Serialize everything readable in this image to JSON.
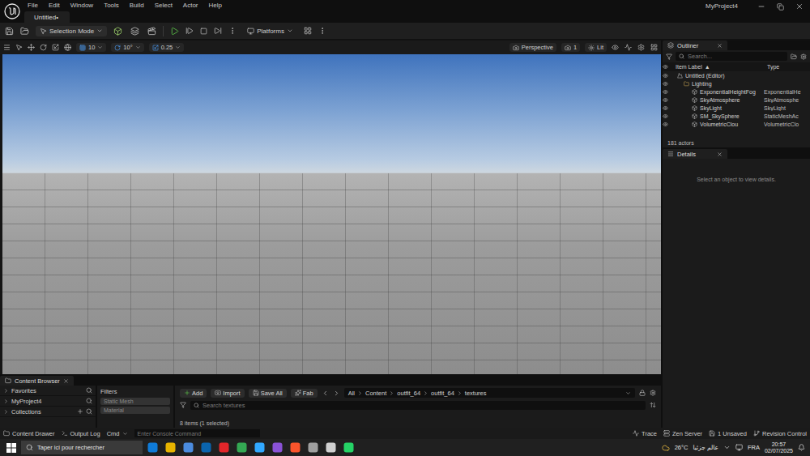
{
  "app": {
    "title": "MyProject4",
    "menu": [
      "File",
      "Edit",
      "Window",
      "Tools",
      "Build",
      "Select",
      "Actor",
      "Help"
    ],
    "document_tab": "Untitled•"
  },
  "toolbar": {
    "mode": "Selection Mode",
    "platforms": "Platforms"
  },
  "viewport_toolbar": {
    "snap_values": [
      "10",
      "10°",
      "0.25"
    ],
    "view": "Perspective",
    "speed": "1",
    "lit": "Lit"
  },
  "outliner": {
    "tab": "Outliner",
    "search_placeholder": "Search...",
    "columns": [
      {
        "label": "Item Label",
        "sort": "▲"
      },
      {
        "label": "Type",
        "sort": ""
      }
    ],
    "rows": [
      {
        "label": "Untitled (Editor)",
        "type": "",
        "kind": "level"
      },
      {
        "label": "Lighting",
        "type": "",
        "kind": "folder"
      },
      {
        "label": "ExponentialHeightFog",
        "type": "ExponentialHe",
        "kind": "actor"
      },
      {
        "label": "SkyAtmosphere",
        "type": "SkyAtmosphe",
        "kind": "actor"
      },
      {
        "label": "SkyLight",
        "type": "SkyLight",
        "kind": "actor"
      },
      {
        "label": "SM_SkySphere",
        "type": "StaticMeshAc",
        "kind": "actor"
      },
      {
        "label": "VolumetricClou",
        "type": "VolumetricClo",
        "kind": "actor"
      }
    ],
    "count": "181 actors"
  },
  "details": {
    "tab": "Details",
    "message": "Select an object to view details."
  },
  "content_browser": {
    "tab": "Content Browser",
    "sources": [
      "Favorites",
      "MyProject4",
      "Collections"
    ],
    "filters_title": "Filters",
    "filters": [
      "Static Mesh",
      "Material"
    ],
    "actions": [
      "Add",
      "Import",
      "Save All",
      "Fab"
    ],
    "path": [
      "All",
      "Content",
      "outfit_64",
      "outfit_64",
      "textures"
    ],
    "search_placeholder": "Search textures",
    "footer": "8 items (1 selected)"
  },
  "status_bar": {
    "left": [
      "Content Drawer",
      "Output Log"
    ],
    "cmd": "Cmd",
    "console_placeholder": "Enter Console Command",
    "right": [
      "Trace",
      "Zen Server",
      "1 Unsaved",
      "Revision Control"
    ]
  },
  "taskbar": {
    "search_placeholder": "Taper ici pour rechercher",
    "temperature": "26°C",
    "weather": "عالم جزئيا",
    "language": "FRA",
    "time": "20:57",
    "date": "02/07/2025"
  }
}
